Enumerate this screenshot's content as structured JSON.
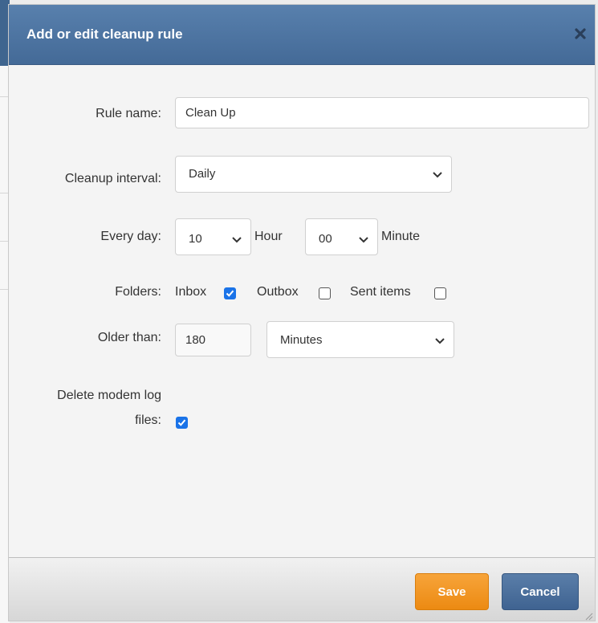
{
  "dialog": {
    "title": "Add or edit cleanup rule",
    "close_icon": "close-x-icon"
  },
  "form": {
    "rule_name": {
      "label": "Rule name:",
      "value": "Clean Up"
    },
    "cleanup_interval": {
      "label": "Cleanup interval:",
      "selected": "Daily"
    },
    "every_day": {
      "label": "Every day:",
      "hour_value": "10",
      "hour_unit": "Hour",
      "minute_value": "00",
      "minute_unit": "Minute"
    },
    "folders": {
      "label": "Folders:",
      "items": [
        {
          "label": "Inbox",
          "checked": true
        },
        {
          "label": "Outbox",
          "checked": false
        },
        {
          "label": "Sent items",
          "checked": false
        }
      ]
    },
    "older_than": {
      "label": "Older than:",
      "value": "180",
      "unit": "Minutes"
    },
    "delete_modem_log": {
      "label_line1": "Delete modem log",
      "label_line2": "files:",
      "checked": true
    }
  },
  "footer": {
    "save_label": "Save",
    "cancel_label": "Cancel"
  },
  "colors": {
    "title_bar": "#4d74a1",
    "save_button": "#f29a28",
    "cancel_button": "#4a6f9c",
    "checkbox_checked": "#1a73e8"
  }
}
